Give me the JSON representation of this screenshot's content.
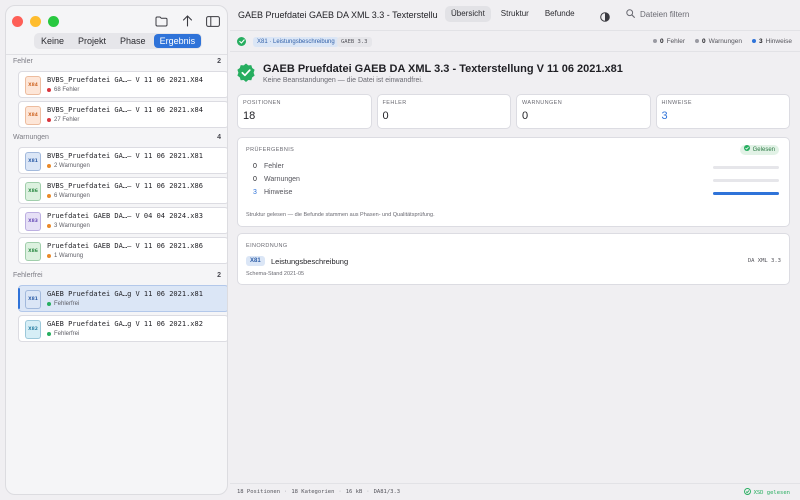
{
  "window": {
    "title": "GAEB Pruefdatei GAEB DA XML 3.3 - Texterstellung V 11 06 2021.x81",
    "title_display": "GAEB Pruefdatei GAEB DA XML 3.3 - Texterstellu..."
  },
  "sidebar": {
    "filters": [
      "Keine",
      "Projekt",
      "Phase",
      "Ergebnis"
    ],
    "active_filter": "Ergebnis",
    "groups": [
      {
        "label": "Fehler",
        "count": "2",
        "items": [
          {
            "badge": "X84",
            "name": "BVBS_Pruefdatei GA…– V 11 06 2021.X84",
            "status": "68 Fehler",
            "status_color": "#d9363e",
            "badge_bg": "#fde6d8",
            "badge_fg": "#d06a2a"
          },
          {
            "badge": "X84",
            "name": "BVBS_Pruefdatei GA…– V 11 06 2021.x84",
            "status": "27 Fehler",
            "status_color": "#d9363e",
            "badge_bg": "#fde6d8",
            "badge_fg": "#d06a2a"
          }
        ]
      },
      {
        "label": "Warnungen",
        "count": "4",
        "items": [
          {
            "badge": "X81",
            "name": "BVBS_Pruefdatei GA…– V 11 06 2021.X81",
            "status": "2 Warnungen",
            "status_color": "#e8892a",
            "badge_bg": "#dbe6f6",
            "badge_fg": "#2f5fa8"
          },
          {
            "badge": "X86",
            "name": "BVBS_Pruefdatei GA…– V 11 06 2021.X86",
            "status": "6 Warnungen",
            "status_color": "#e8892a",
            "badge_bg": "#dcf1df",
            "badge_fg": "#2b8a44"
          },
          {
            "badge": "X83",
            "name": "Pruefdatei GAEB DA…– V 04 04 2024.x83",
            "status": "3 Warnungen",
            "status_color": "#e8892a",
            "badge_bg": "#e6e0f6",
            "badge_fg": "#6a4fb8"
          },
          {
            "badge": "X86",
            "name": "Pruefdatei GAEB DA…– V 11 06 2021.x86",
            "status": "1 Warnung",
            "status_color": "#e8892a",
            "badge_bg": "#dcf1df",
            "badge_fg": "#2b8a44"
          }
        ]
      },
      {
        "label": "Fehlerfrei",
        "count": "2",
        "items": [
          {
            "badge": "X81",
            "name": "GAEB Pruefdatei GA…g V 11 06 2021.x81",
            "status": "Fehlerfrei",
            "status_color": "#27ae60",
            "badge_bg": "#dbe6f6",
            "badge_fg": "#2f5fa8",
            "selected": true
          },
          {
            "badge": "X82",
            "name": "GAEB Pruefdatei GA…g V 11 06 2021.x82",
            "status": "Fehlerfrei",
            "status_color": "#27ae60",
            "badge_bg": "#d6eef6",
            "badge_fg": "#2a7fa3"
          }
        ]
      }
    ]
  },
  "toolbar": {
    "tabs": [
      "Übersicht",
      "Struktur",
      "Befunde"
    ],
    "active_tab": "Übersicht",
    "search_placeholder": "Dateien filtern"
  },
  "status_strip": {
    "type_tag": "X81 · Leistungsbeschreibung",
    "version_tag": "GAEB 3.3",
    "counts": [
      {
        "value": "0",
        "label": "Fehler",
        "color": "#9a9aa2"
      },
      {
        "value": "0",
        "label": "Warnungen",
        "color": "#9a9aa2"
      },
      {
        "value": "3",
        "label": "Hinweise",
        "color": "#2f73d9"
      }
    ]
  },
  "header": {
    "title": "GAEB Pruefdatei GAEB DA XML 3.3 - Texterstellung V 11 06 2021.x81",
    "subtitle": "Keine Beanstandungen — die Datei ist einwandfrei."
  },
  "stats": [
    {
      "label": "POSITIONEN",
      "value": "18",
      "color": "#1f1f24"
    },
    {
      "label": "FEHLER",
      "value": "0",
      "color": "#1f1f24"
    },
    {
      "label": "WARNUNGEN",
      "value": "0",
      "color": "#1f1f24"
    },
    {
      "label": "HINWEISE",
      "value": "3",
      "color": "#2f73d9"
    }
  ],
  "result": {
    "title": "PRÜFERGEBNIS",
    "badge": "Gelesen",
    "rows": [
      {
        "value": "0",
        "label": "Fehler",
        "fraction": 0,
        "value_color": "#1f1f24"
      },
      {
        "value": "0",
        "label": "Warnungen",
        "fraction": 0,
        "value_color": "#1f1f24"
      },
      {
        "value": "3",
        "label": "Hinweise",
        "fraction": 1,
        "value_color": "#2f73d9"
      }
    ],
    "footnote": "Struktur gelesen — die Befunde stammen aus Phasen- und Qualitätsprüfung."
  },
  "classification": {
    "title": "EINORDNUNG",
    "tag": "X81",
    "label": "Leistungsbeschreibung",
    "version": "DA XML 3.3",
    "schema": "Schema-Stand 2021-05"
  },
  "footer": {
    "items": [
      "18 Positionen",
      "18 Kategorien",
      "16 kB",
      "DA81/3.3"
    ],
    "xsd_status": "XSD gelesen"
  },
  "colors": {
    "accent": "#2f73d9",
    "success": "#27ae60",
    "error": "#d9363e",
    "warning": "#e8892a"
  }
}
